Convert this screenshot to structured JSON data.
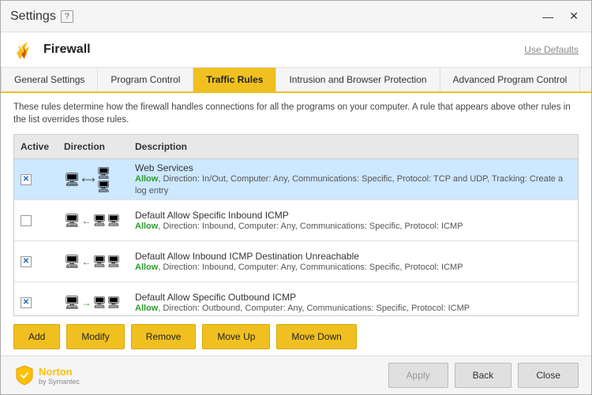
{
  "window": {
    "title": "Settings",
    "help_label": "?",
    "minimize_icon": "—",
    "close_icon": "✕"
  },
  "header": {
    "brand_name": "Firewall",
    "use_defaults_label": "Use Defaults"
  },
  "tabs": [
    {
      "id": "general",
      "label": "General Settings",
      "active": false
    },
    {
      "id": "program",
      "label": "Program Control",
      "active": false
    },
    {
      "id": "traffic",
      "label": "Traffic Rules",
      "active": true
    },
    {
      "id": "intrusion",
      "label": "Intrusion and Browser Protection",
      "active": false
    },
    {
      "id": "advanced",
      "label": "Advanced Program Control",
      "active": false
    }
  ],
  "description": "These rules determine how the firewall handles connections for all the programs on your computer. A rule that appears above other rules in the list overrides those rules.",
  "table": {
    "columns": [
      "Active",
      "Direction",
      "Description"
    ],
    "rows": [
      {
        "checked": true,
        "selected": true,
        "direction": "inout",
        "title": "Web Services",
        "detail": "Allow, Direction: In/Out, Computer: Any, Communications: Specific, Protocol: TCP and UDP, Tracking: Create a log entry"
      },
      {
        "checked": false,
        "selected": false,
        "direction": "in",
        "title": "Default Allow Specific Inbound ICMP",
        "detail": "Allow, Direction: Inbound, Computer: Any, Communications: Specific, Protocol: ICMP"
      },
      {
        "checked": true,
        "selected": false,
        "direction": "in",
        "title": "Default Allow Inbound ICMP Destination Unreachable",
        "detail": "Allow, Direction: Inbound, Computer: Any, Communications: Specific, Protocol: ICMP"
      },
      {
        "checked": true,
        "selected": false,
        "direction": "out",
        "title": "Default Allow Specific Outbound ICMP",
        "detail": "Allow, Direction: Outbound, Computer: Any, Communications: Specific, Protocol: ICMP"
      }
    ]
  },
  "buttons": {
    "add": "Add",
    "modify": "Modify",
    "remove": "Remove",
    "move_up": "Move Up",
    "move_down": "Move Down"
  },
  "footer": {
    "norton_name": "Norton",
    "norton_sub": "by Symantec",
    "apply": "Apply",
    "back": "Back",
    "close": "Close"
  }
}
